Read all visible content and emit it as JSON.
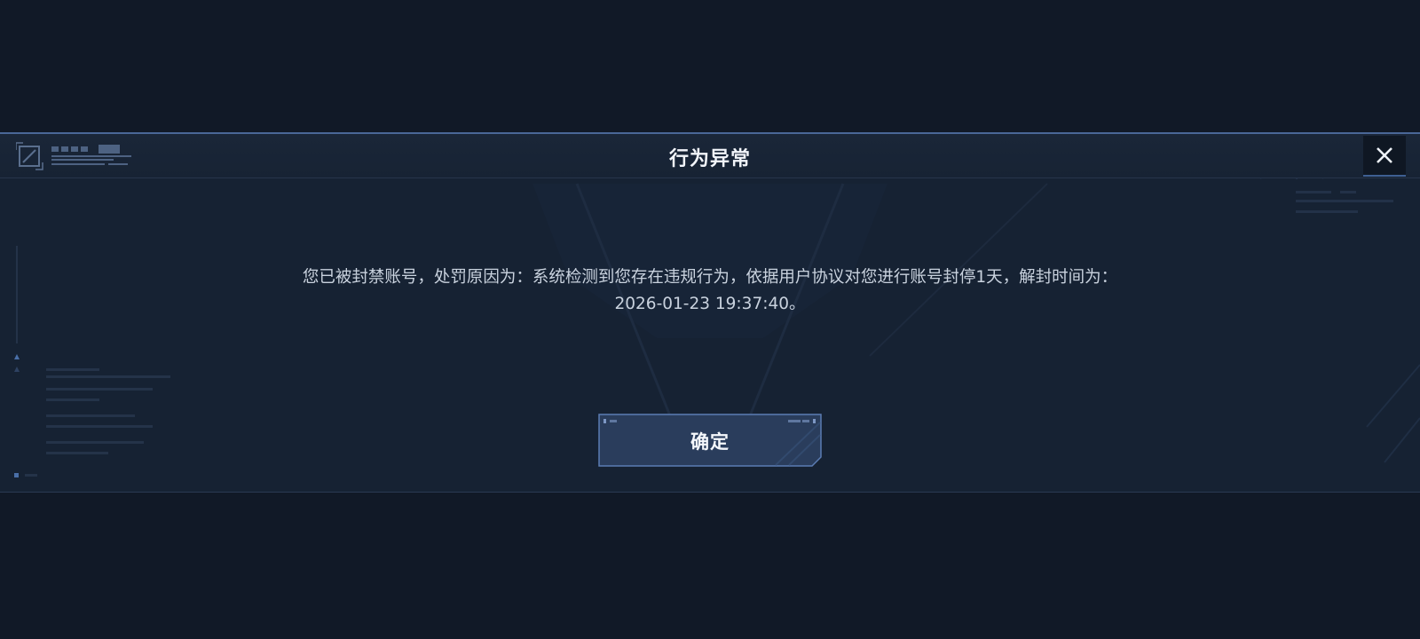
{
  "dialog": {
    "title": "行为异常",
    "message": "您已被封禁账号，处罚原因为：系统检测到您存在违规行为，依据用户协议对您进行账号封停1天，解封时间为：2026-01-23 19:37:40。",
    "confirm_label": "确定",
    "close_icon": "close-icon",
    "logo_icon": "logo-icon"
  },
  "colors": {
    "background": "#111927",
    "panel": "#162233",
    "accent": "#4a6797",
    "button": "#2a3d5c"
  }
}
